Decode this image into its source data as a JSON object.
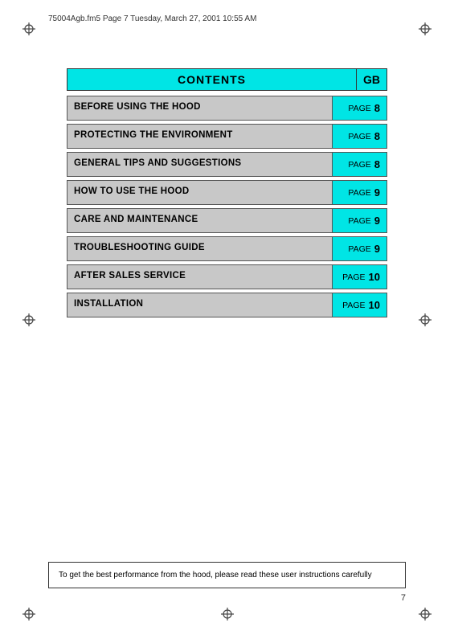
{
  "header": {
    "text": "75004Agb.fm5  Page 7  Tuesday, March 27, 2001  10:55 AM"
  },
  "contents": {
    "title": "CONTENTS",
    "gb_label": "GB"
  },
  "toc_items": [
    {
      "label": "BEFORE USING THE HOOD",
      "page_word": "PAGE",
      "page_num": "8"
    },
    {
      "label": "PROTECTING THE ENVIRONMENT",
      "page_word": "PAGE",
      "page_num": "8"
    },
    {
      "label": "GENERAL TIPS AND SUGGESTIONS",
      "page_word": "PAGE",
      "page_num": "8"
    },
    {
      "label": "HOW TO USE THE HOOD",
      "page_word": "PAGE",
      "page_num": "9"
    },
    {
      "label": "CARE AND MAINTENANCE",
      "page_word": "PAGE",
      "page_num": "9"
    },
    {
      "label": "TROUBLESHOOTING GUIDE",
      "page_word": "PAGE",
      "page_num": "9"
    },
    {
      "label": "AFTER SALES SERVICE",
      "page_word": "PAGE",
      "page_num": "10"
    },
    {
      "label": "INSTALLATION",
      "page_word": "PAGE",
      "page_num": "10"
    }
  ],
  "bottom_note": "To get the best performance from the hood, please read these user instructions carefully",
  "page_number": "7"
}
